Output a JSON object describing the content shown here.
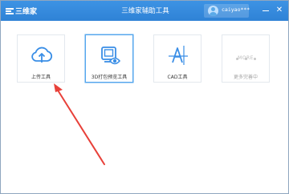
{
  "app": {
    "logo_text": "三维家",
    "title": "三维家辅助工具",
    "username": "caiyao***"
  },
  "window_controls": {
    "minimize_icon": "minimize-icon",
    "close_icon": "close-icon",
    "close_glyph": "✕"
  },
  "tools": [
    {
      "label": "上传工具",
      "icon": "cloud-upload-icon",
      "selected": false
    },
    {
      "label": "3D打包预览工具",
      "icon": "3d-preview-icon",
      "selected": true
    },
    {
      "label": "CAD工具",
      "icon": "cad-icon",
      "selected": false
    },
    {
      "label": "更多完善中",
      "icon": "more-icon",
      "sublabel": "MORE",
      "disabled": true
    }
  ],
  "colors": {
    "titlebar": "#2f82d6",
    "accent": "#3a8ee6",
    "arrow": "#e8413a"
  }
}
